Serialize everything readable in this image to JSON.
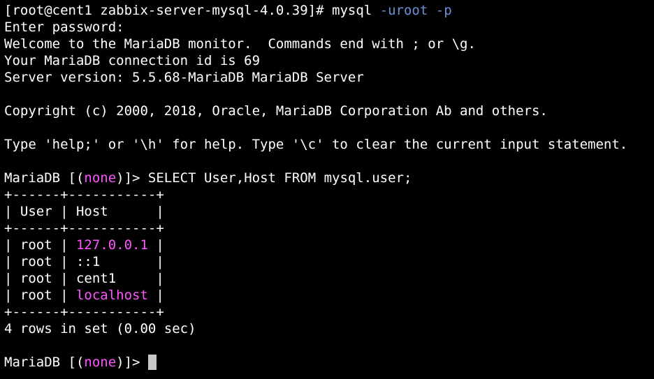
{
  "terminal": {
    "prompt_user_host": "[root@cent1 zabbix-server-mysql-4.0.39]# ",
    "command": "mysql",
    "arg1": "-uroot",
    "arg2": "-p",
    "enter_password": "Enter password:",
    "welcome": "Welcome to the MariaDB monitor.  Commands end with ; or \\g.",
    "connection_id": "Your MariaDB connection id is 69",
    "server_version": "Server version: 5.5.68-MariaDB MariaDB Server",
    "copyright": "Copyright (c) 2000, 2018, Oracle, MariaDB Corporation Ab and others.",
    "help_text": "Type 'help;' or '\\h' for help. Type '\\c' to clear the current input statement.",
    "mariadb_prefix": "MariaDB [(",
    "db_none": "none",
    "mariadb_suffix": ")]> ",
    "sql_query": "SELECT User,Host FROM mysql.user;",
    "table_border": "+------+-----------+",
    "header_left": "| ",
    "header_user": "User",
    "header_mid": " | ",
    "header_host": "Host",
    "header_right": "      |",
    "rows": [
      {
        "user": "root",
        "host": "127.0.0.1",
        "pad": " ",
        "host_color": "#ff55ff"
      },
      {
        "user": "root",
        "host": "::1",
        "pad": "       ",
        "host_color": "#ffffff"
      },
      {
        "user": "root",
        "host": "cent1",
        "pad": "     ",
        "host_color": "#ffffff"
      },
      {
        "user": "root",
        "host": "localhost",
        "pad": " ",
        "host_color": "#ff55ff"
      }
    ],
    "row_prefix": "| ",
    "row_mid": " | ",
    "row_end": "|",
    "rows_summary": "4 rows in set (0.00 sec)"
  },
  "colors": {
    "background": "#000000",
    "foreground": "#ffffff",
    "arg_blue": "#6e8fd6",
    "highlight_magenta": "#ff55ff",
    "cursor": "#c8c8c8"
  }
}
